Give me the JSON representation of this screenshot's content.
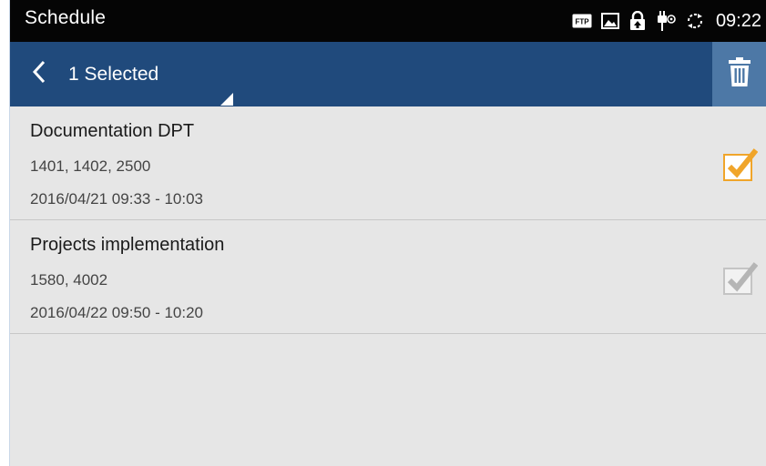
{
  "status_bar": {
    "title": "Schedule",
    "time": "09:22",
    "icons": [
      "ftp-icon",
      "image-icon",
      "lock-icon",
      "usb-icon",
      "sync-icon"
    ],
    "ftp_label": "FTP"
  },
  "action_bar": {
    "back_icon": "chevron-left-icon",
    "selection_label": "1 Selected",
    "delete_icon": "trash-icon",
    "background_color": "#204a7c",
    "delete_button_color": "#4d78a6"
  },
  "schedule_items": [
    {
      "title": "Documentation DPT",
      "extensions": "1401, 1402, 2500",
      "time_range": "2016/04/21 09:33 - 10:03",
      "checked": true,
      "check_color": "#f0a52a"
    },
    {
      "title": "Projects implementation",
      "extensions": "1580, 4002",
      "time_range": "2016/04/22 09:50 - 10:20",
      "checked": false,
      "check_color": "#b5b5b5"
    }
  ]
}
